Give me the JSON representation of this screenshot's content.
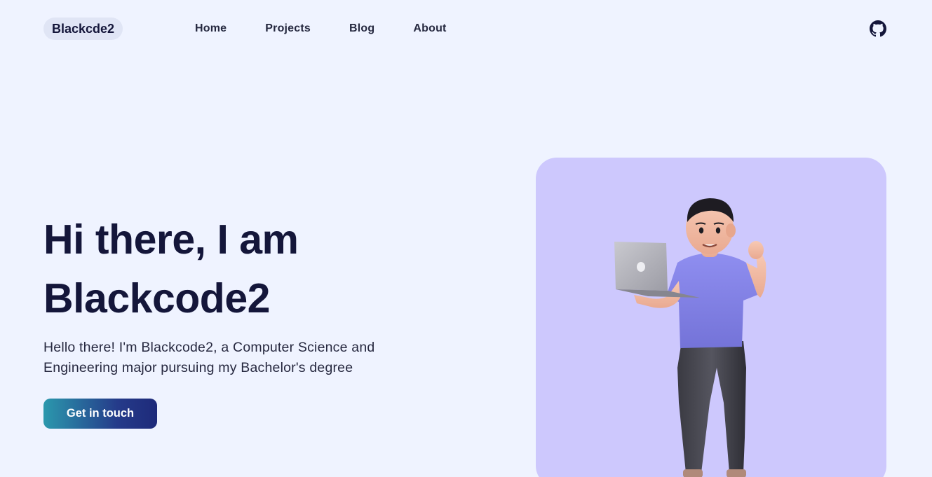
{
  "header": {
    "brand": "Blackcde2",
    "nav": [
      {
        "label": "Home"
      },
      {
        "label": "Projects"
      },
      {
        "label": "Blog"
      },
      {
        "label": "About"
      }
    ],
    "github_icon": "github-icon"
  },
  "hero": {
    "title_line1": "Hi there, I am",
    "title_line2": "Blackcode2",
    "description": "Hello there! I'm Blackcode2, a Computer Science and Engineering major pursuing my Bachelor's degree",
    "cta_label": "Get in touch",
    "illustration": "3d-character-with-laptop"
  },
  "colors": {
    "background": "#eff3ff",
    "brand_pill": "#e0e5f5",
    "text_dark": "#14163a",
    "card_bg": "#cdc8fd",
    "cta_gradient_start": "#2b98ad",
    "cta_gradient_end": "#1e2a7a"
  }
}
